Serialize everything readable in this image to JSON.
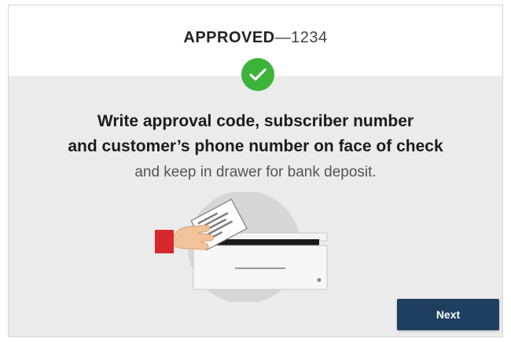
{
  "header": {
    "status": "APPROVED",
    "separator": "—",
    "approval_code": "1234"
  },
  "status_icon": "check-circle-icon",
  "colors": {
    "success_green": "#3cb339",
    "primary_button": "#1f3f5f",
    "hand_cuff": "#d9282d"
  },
  "instructions": {
    "line1": "Write approval code, subscriber number",
    "line2": "and customer’s phone number on face of check",
    "line3": "and keep in drawer for bank deposit."
  },
  "illustration": {
    "icon": "hand-check-cash-drawer-icon"
  },
  "actions": {
    "next_label": "Next"
  }
}
